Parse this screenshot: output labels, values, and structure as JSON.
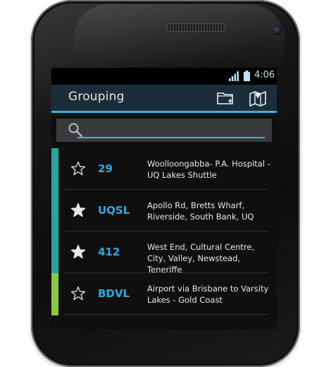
{
  "status_bar": {
    "time": "4:06",
    "signal_icon": "signal-icon",
    "battery_icon": "battery-icon"
  },
  "action_bar": {
    "title": "Grouping",
    "folder_icon": "new-folder-icon",
    "map_icon": "map-icon"
  },
  "search": {
    "value": "",
    "placeholder": "",
    "icon": "search-icon"
  },
  "routes": [
    {
      "code": "29",
      "description": "Woolloongabba- P.A. Hospital - UQ Lakes Shuttle",
      "starred": false,
      "group_color": "#1fa99a"
    },
    {
      "code": "UQSL",
      "description": "Apollo Rd, Bretts Wharf, Riverside, South Bank, UQ",
      "starred": true,
      "group_color": "#1fa99a"
    },
    {
      "code": "412",
      "description": "West End, Cultural Centre, City, Valley, Newstead, Teneriffe",
      "starred": true,
      "group_color": "#1fa99a"
    },
    {
      "code": "BDVL",
      "description": "Airport via Brisbane to Varsity Lakes - Gold Coast",
      "starred": false,
      "group_color": "#8cc63f"
    }
  ],
  "colors": {
    "accent": "#33b5e5",
    "route_code": "#33a8dc",
    "action_bar": "#1b2d38"
  }
}
